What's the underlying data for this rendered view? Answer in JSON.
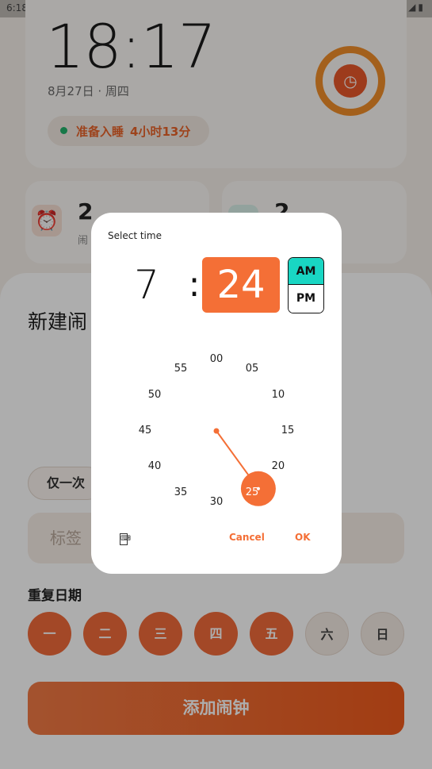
{
  "status_bar": {
    "time": "6:18"
  },
  "home": {
    "clock_time": "18:17",
    "date_line": "8月27日 · 周四",
    "sleep_label": "准备入睡",
    "sleep_remaining": "4小时13分",
    "mini_left_count": "2",
    "mini_left_sub": "闹",
    "mini_right_count": "2"
  },
  "sheet": {
    "title": "新建闹",
    "repeat_chip": "仅一次",
    "label_placeholder": "标签",
    "repeat_title": "重复日期",
    "days": [
      "一",
      "二",
      "三",
      "四",
      "五",
      "六",
      "日"
    ],
    "days_selected": [
      true,
      true,
      true,
      true,
      true,
      false,
      false
    ],
    "add_button": "添加闹钟"
  },
  "time_picker": {
    "title": "Select time",
    "hour": "7",
    "separator": ":",
    "minute": "24",
    "am_label": "AM",
    "pm_label": "PM",
    "period_selected": "AM",
    "dial_labels": [
      "00",
      "05",
      "10",
      "15",
      "20",
      "25",
      "30",
      "35",
      "40",
      "45",
      "50",
      "55"
    ],
    "selected_minute_value": 24,
    "keyboard_toggle_icon": "keyboard-icon",
    "cancel_label": "Cancel",
    "ok_label": "OK",
    "accent_color": "#f46f36",
    "am_highlight_color": "#19d6c3"
  }
}
